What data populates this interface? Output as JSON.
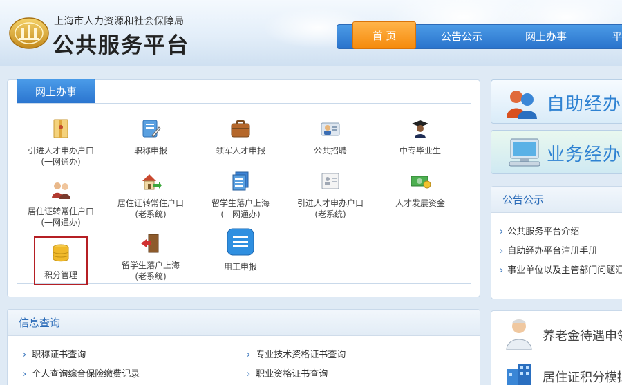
{
  "header": {
    "agency": "上海市人力资源和社会保障局",
    "platform": "公共服务平台",
    "nav": [
      {
        "label": "首 页",
        "active": true
      },
      {
        "label": "公告公示",
        "active": false
      },
      {
        "label": "网上办事",
        "active": false
      },
      {
        "label": "平",
        "active": false
      }
    ]
  },
  "services": {
    "tab": "网上办事",
    "items": [
      {
        "icon": "envelope-folder-icon",
        "line1": "引进人才申办户口",
        "line2": "(一网通办)"
      },
      {
        "icon": "certificate-edit-icon",
        "line1": "职称申报",
        "line2": ""
      },
      {
        "icon": "briefcase-icon",
        "line1": "领军人才申报",
        "line2": ""
      },
      {
        "icon": "recruit-person-icon",
        "line1": "公共招聘",
        "line2": ""
      },
      {
        "icon": "graduate-icon",
        "line1": "中专毕业生",
        "line2": ""
      },
      {
        "icon": "couple-icon",
        "line1": "居住证转常住户口",
        "line2": "(一网通办)"
      },
      {
        "icon": "house-arrow-icon",
        "line1": "居住证转常住户口",
        "line2": "(老系统)"
      },
      {
        "icon": "documents-icon",
        "line1": "留学生落户上海",
        "line2": "(一网通办)"
      },
      {
        "icon": "id-card-icon",
        "line1": "引进人才申办户口",
        "line2": "(老系统)"
      },
      {
        "icon": "money-icon",
        "line1": "人才发展资金",
        "line2": ""
      },
      {
        "icon": "coin-stack-icon",
        "line1": "积分管理",
        "line2": ""
      },
      {
        "icon": "door-exit-icon",
        "line1": "留学生落户上海",
        "line2": "(老系统)"
      },
      {
        "icon": "list-document-icon",
        "line1": "用工申报",
        "line2": ""
      }
    ]
  },
  "banners": [
    {
      "label": "自助经办系",
      "color": "#2f82d2"
    },
    {
      "label": "业务经办系",
      "color": "#2f82d2"
    }
  ],
  "notice": {
    "title": "公告公示",
    "items": [
      "公共服务平台介绍",
      "自助经办平台注册手册",
      "事业单位以及主管部门问题汇"
    ]
  },
  "info": {
    "title": "信息查询",
    "items": [
      "职称证书查询",
      "专业技术资格证书查询",
      "个人查询综合保险缴费记录",
      "职业资格证书查询"
    ]
  },
  "right_services": [
    "养老金待遇申领",
    "居住证积分模拟"
  ]
}
